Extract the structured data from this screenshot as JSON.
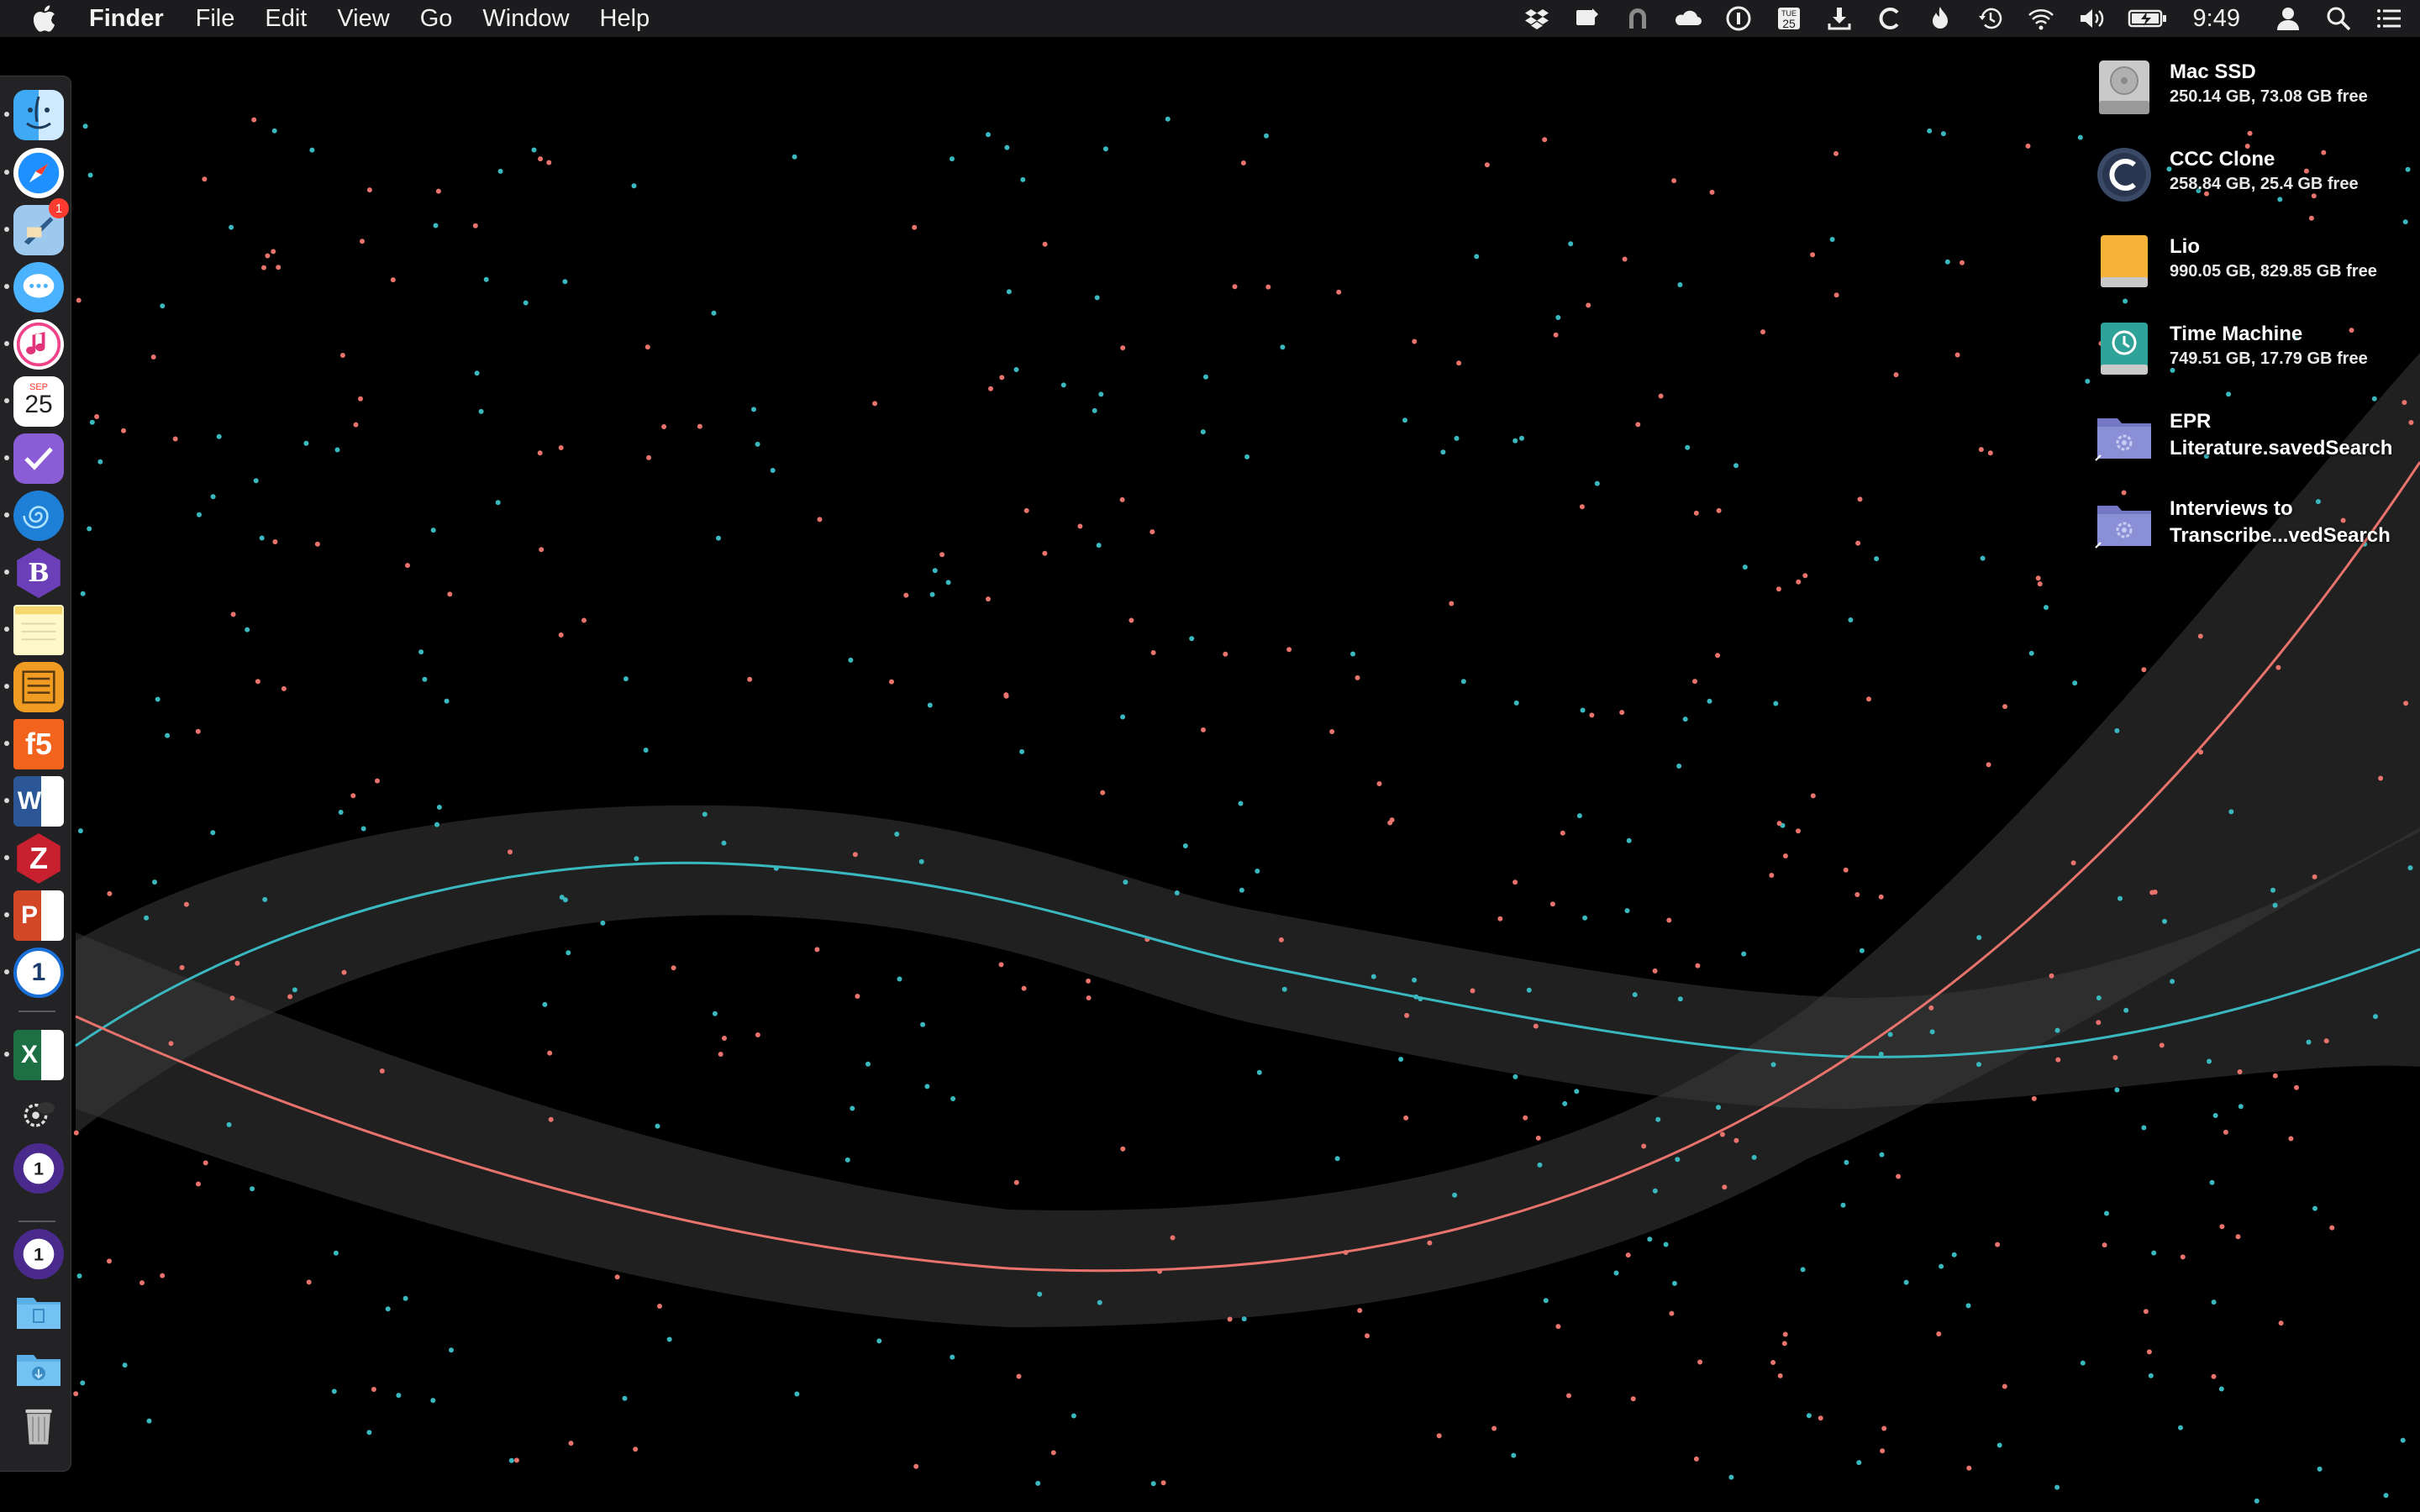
{
  "menubar": {
    "apple_icon": "apple-logo-icon",
    "app_name": "Finder",
    "menus": [
      "File",
      "Edit",
      "View",
      "Go",
      "Window",
      "Help"
    ],
    "status_icons": [
      "dropbox-icon",
      "notification-icon",
      "arc-icon",
      "cloud-icon",
      "1password-icon",
      "calendar-date-icon",
      "download-icon",
      "ccc-icon",
      "flame-icon",
      "time-machine-icon",
      "wifi-icon",
      "volume-icon",
      "battery-icon"
    ],
    "calendar_day": "TUE",
    "calendar_date": "25",
    "clock": "9:49",
    "right_icons": [
      "user-icon",
      "spotlight-search-icon",
      "notification-center-icon"
    ]
  },
  "dock": {
    "mail_badge": "1",
    "calendar_month": "SEP",
    "calendar_day": "25",
    "items": [
      {
        "name": "finder-app-icon"
      },
      {
        "name": "safari-app-icon"
      },
      {
        "name": "mail-app-icon"
      },
      {
        "name": "messages-app-icon"
      },
      {
        "name": "itunes-app-icon"
      },
      {
        "name": "calendar-app-icon"
      },
      {
        "name": "omnifocus-app-icon"
      },
      {
        "name": "nautilus-app-icon"
      },
      {
        "name": "bbedit-app-icon"
      },
      {
        "name": "notes-app-icon"
      },
      {
        "name": "scrivener-app-icon"
      },
      {
        "name": "f5-app-icon"
      },
      {
        "name": "word-app-icon"
      },
      {
        "name": "zotero-app-icon"
      },
      {
        "name": "powerpoint-app-icon"
      },
      {
        "name": "1password-app-icon"
      },
      {
        "name": "excel-app-icon"
      },
      {
        "name": "bartender-app-icon"
      },
      {
        "name": "1password-mini-icon"
      },
      {
        "name": "1password-alt-icon"
      },
      {
        "name": "documents-folder-icon"
      },
      {
        "name": "downloads-folder-icon"
      },
      {
        "name": "trash-icon"
      }
    ],
    "labels": {
      "f5": "f5",
      "word": "W",
      "zotero": "Z",
      "powerpoint": "P",
      "excel": "X",
      "bbedit": "B",
      "onepass": "1"
    }
  },
  "desktop": {
    "items": [
      {
        "title": "Mac SSD",
        "subtitle": "250.14 GB, 73.08 GB free"
      },
      {
        "title": "CCC Clone",
        "subtitle": "258.84 GB, 25.4 GB free"
      },
      {
        "title": "Lio",
        "subtitle": "990.05 GB, 829.85 GB free"
      },
      {
        "title": "Time Machine",
        "subtitle": "749.51 GB, 17.79 GB free"
      },
      {
        "title": "EPR",
        "subtitle": "Literature.savedSearch"
      },
      {
        "title": "Interviews to",
        "subtitle": "Transcribe...vedSearch"
      }
    ]
  },
  "colors": {
    "menubar": "#1c1c1e",
    "teal_line": "#3ab8c0",
    "red_line": "#e8726c",
    "band": "#3a3a3a",
    "lio_drive": "#f6b33a",
    "time_machine": "#2fa39a",
    "saved_search": "#8b8fd6"
  }
}
